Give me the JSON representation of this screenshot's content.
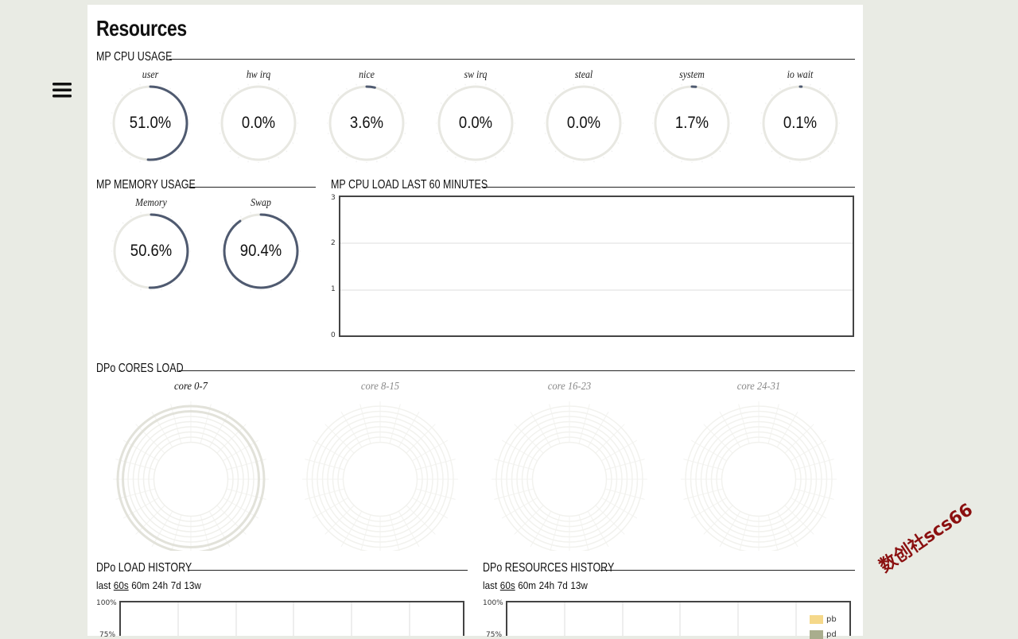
{
  "page": {
    "title": "Resources"
  },
  "menu": {
    "icon": "hamburger-menu-icon"
  },
  "cpu_usage": {
    "heading": "MP CPU USAGE",
    "gauges": [
      {
        "label": "user",
        "value": "51.0%",
        "fraction": 0.51
      },
      {
        "label": "hw irq",
        "value": "0.0%",
        "fraction": 0.0
      },
      {
        "label": "nice",
        "value": "3.6%",
        "fraction": 0.036
      },
      {
        "label": "sw irq",
        "value": "0.0%",
        "fraction": 0.0
      },
      {
        "label": "steal",
        "value": "0.0%",
        "fraction": 0.0
      },
      {
        "label": "system",
        "value": "1.7%",
        "fraction": 0.017
      },
      {
        "label": "io wait",
        "value": "0.1%",
        "fraction": 0.001
      }
    ]
  },
  "memory_usage": {
    "heading": "MP MEMORY USAGE",
    "gauges": [
      {
        "label": "Memory",
        "value": "50.6%",
        "fraction": 0.506
      },
      {
        "label": "Swap",
        "value": "90.4%",
        "fraction": 0.904
      }
    ]
  },
  "cpu_load": {
    "heading": "MP CPU LOAD LAST 60 MINUTES",
    "y_ticks": [
      "3",
      "2",
      "1",
      "0"
    ]
  },
  "cores_load": {
    "heading": "DPo CORES LOAD",
    "groups": [
      {
        "label": "core 0-7",
        "active": true
      },
      {
        "label": "core 8-15",
        "active": false
      },
      {
        "label": "core 16-23",
        "active": false
      },
      {
        "label": "core 24-31",
        "active": false
      }
    ]
  },
  "load_history": {
    "heading": "DPo LOAD HISTORY",
    "prefix": "last",
    "periods": [
      "60s",
      "60m",
      "24h",
      "7d",
      "13w"
    ],
    "selected": "60s",
    "y_top": "100%",
    "y_next": "75%"
  },
  "resources_history": {
    "heading": "DPo RESOURCES HISTORY",
    "prefix": "last",
    "periods": [
      "60s",
      "60m",
      "24h",
      "7d",
      "13w"
    ],
    "selected": "60s",
    "y_top": "100%",
    "y_next": "75%",
    "legend": [
      {
        "name": "pb",
        "color": "#f5d88a"
      },
      {
        "name": "pd",
        "color": "#a9ad8d"
      }
    ]
  },
  "colors": {
    "gauge_arc": "#4f5a70",
    "gauge_track": "#e8e8e2",
    "accent": "#8b1010"
  },
  "watermark": "数创社scs66"
}
